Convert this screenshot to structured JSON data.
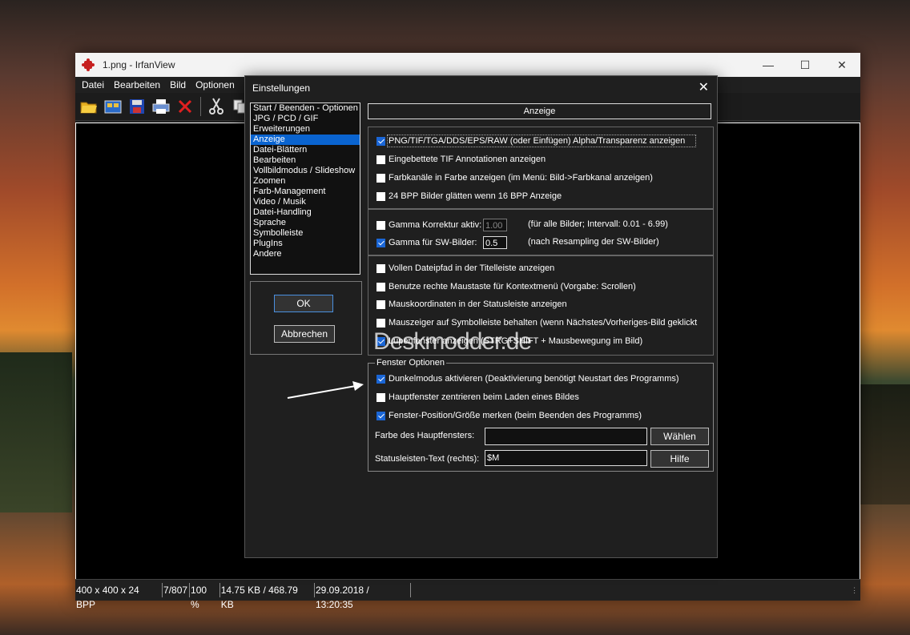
{
  "window": {
    "title": "1.png - IrfanView"
  },
  "menu": [
    "Datei",
    "Bearbeiten",
    "Bild",
    "Optionen"
  ],
  "status": [
    "400 x 400 x 24 BPP",
    "7/807",
    "100 %",
    "14.75 KB / 468.79 KB",
    "29.09.2018 / 13:20:35"
  ],
  "dialog": {
    "title": "Einstellungen",
    "list": [
      "Start / Beenden - Optionen",
      "JPG / PCD / GIF",
      "Erweiterungen",
      "Anzeige",
      "Datei-Blättern",
      "Bearbeiten",
      "Vollbildmodus / Slideshow",
      "Zoomen",
      "Farb-Management",
      "Video / Musik",
      "Datei-Handling",
      "Sprache",
      "Symbolleiste",
      "PlugIns",
      "Andere"
    ],
    "selected_index": 3,
    "ok": "OK",
    "cancel": "Abbrechen",
    "heading": "Anzeige",
    "group1": [
      {
        "label": "PNG/TIF/TGA/DDS/EPS/RAW (oder Einfügen) Alpha/Transparenz anzeigen",
        "checked": true
      },
      {
        "label": "Eingebettete TIF Annotationen anzeigen",
        "checked": false
      },
      {
        "label": "Farbkanäle in Farbe anzeigen (im Menü: Bild->Farbkanal anzeigen)",
        "checked": false
      },
      {
        "label": "24 BPP Bilder glätten wenn 16 BPP Anzeige",
        "checked": false
      }
    ],
    "gamma": {
      "label": "Gamma Korrektur aktiv:",
      "checked": false,
      "value": "1.00",
      "note": "(für alle Bilder; Intervall: 0.01 - 6.99)",
      "sw_label": "Gamma für SW-Bilder:",
      "sw_checked": true,
      "sw_value": "0.5",
      "sw_note": "(nach Resampling der SW-Bilder)"
    },
    "group3": [
      {
        "label": "Vollen Dateipfad in der Titelleiste anzeigen",
        "checked": false
      },
      {
        "label": "Benutze rechte Maustaste für Kontextmenü  (Vorgabe: Scrollen)",
        "checked": false
      },
      {
        "label": "Mauskoordinaten in der Statusleiste anzeigen",
        "checked": false
      },
      {
        "label": "Mauszeiger auf Symbolleiste behalten (wenn Nächstes/Vorheriges-Bild geklickt",
        "checked": false
      },
      {
        "label": "Lupenfenster anzeigen (STRG+SHIFT + Mausbewegung im Bild)",
        "checked": true
      }
    ],
    "fenster": {
      "legend": "Fenster Optionen",
      "items": [
        {
          "label": "Dunkelmodus aktivieren (Deaktivierung benötigt Neustart des Programms)",
          "checked": true
        },
        {
          "label": "Hauptfenster zentrieren beim Laden eines Bildes",
          "checked": false
        },
        {
          "label": "Fenster-Position/Größe merken (beim Beenden des Programms)",
          "checked": true
        }
      ],
      "color_label": "Farbe des Hauptfensters:",
      "color_value": "",
      "choose": "Wählen",
      "status_label": "Statusleisten-Text (rechts):",
      "status_value": "$M",
      "help": "Hilfe"
    }
  },
  "watermark": "Deskmodder.de"
}
